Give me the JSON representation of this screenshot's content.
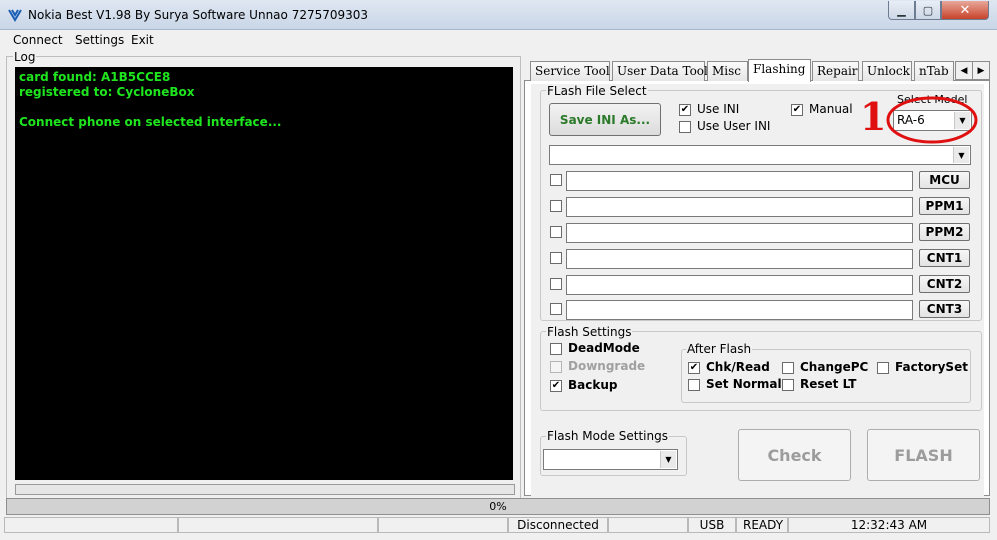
{
  "window": {
    "title": "Nokia Best V1.98 By Surya Software Unnao 7275709303",
    "controls": [
      "minimize",
      "maximize",
      "close"
    ]
  },
  "menu": [
    "Connect",
    "Settings",
    "Exit"
  ],
  "log": {
    "label": "Log",
    "lines": [
      "card found: A1B5CCE8",
      "registered to: CycloneBox",
      "",
      "Connect phone on selected interface..."
    ],
    "text_color": "#1ee51e"
  },
  "tabs": [
    "Service Tool",
    "User Data Tool",
    "Misc",
    "Flashing",
    "Repair",
    "Unlock",
    "nTab"
  ],
  "active_tab": "Flashing",
  "flash_file_select": {
    "label": "FLash File Select",
    "save_ini_button": "Save INI As...",
    "use_ini": {
      "label": "Use INI",
      "checked": true
    },
    "use_user_ini": {
      "label": "Use User INI",
      "checked": false
    },
    "manual": {
      "label": "Manual",
      "checked": true
    },
    "select_model_label": "Select Model",
    "model_value": "RA-6",
    "annotation": "1",
    "file_rows": [
      {
        "button": "MCU",
        "checked": false,
        "path": ""
      },
      {
        "button": "PPM1",
        "checked": false,
        "path": ""
      },
      {
        "button": "PPM2",
        "checked": false,
        "path": ""
      },
      {
        "button": "CNT1",
        "checked": false,
        "path": ""
      },
      {
        "button": "CNT2",
        "checked": false,
        "path": ""
      },
      {
        "button": "CNT3",
        "checked": false,
        "path": ""
      }
    ]
  },
  "flash_settings": {
    "label": "Flash Settings",
    "options": [
      {
        "label": "DeadMode",
        "checked": false,
        "enabled": true
      },
      {
        "label": "Downgrade",
        "checked": false,
        "enabled": false
      },
      {
        "label": "Backup",
        "checked": true,
        "enabled": true
      }
    ],
    "after_flash": {
      "label": "After Flash",
      "options": [
        {
          "label": "Chk/Read",
          "checked": true
        },
        {
          "label": "ChangePC",
          "checked": false
        },
        {
          "label": "FactorySet",
          "checked": false
        },
        {
          "label": "Set Normal",
          "checked": false
        },
        {
          "label": "Reset LT",
          "checked": false
        }
      ]
    }
  },
  "flash_mode_settings": {
    "label": "Flash Mode Settings",
    "value": ""
  },
  "buttons": {
    "check": "Check",
    "flash": "FLASH"
  },
  "progress": {
    "text": "0%",
    "fraction": 0
  },
  "status_bar": {
    "connection": "Disconnected",
    "interface": "USB",
    "state": "READY",
    "time": "12:32:43 AM"
  },
  "colors": {
    "accent_green": "#2a7a2a",
    "annotation_red": "#e01010",
    "title_bar": "#c9d6e7"
  }
}
